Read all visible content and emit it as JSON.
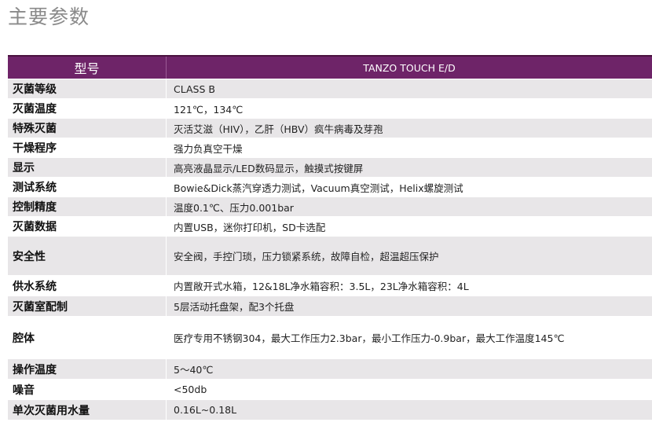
{
  "page": {
    "title": "主要参数"
  },
  "table": {
    "header": {
      "label": "型号",
      "value": "TANZO TOUCH E/D"
    },
    "rows": [
      {
        "label": "灭菌等级",
        "value": "CLASS B"
      },
      {
        "label": "灭菌温度",
        "value": "121℃，134℃"
      },
      {
        "label": "特殊灭菌",
        "value": "灭活艾滋（HIV），乙肝（HBV）疯牛病毒及芽孢"
      },
      {
        "label": "干燥程序",
        "value": "强力负真空干燥"
      },
      {
        "label": "显示",
        "value": "高亮液晶显示/LED数码显示，触摸式按键屏"
      },
      {
        "label": "测试系统",
        "value": "Bowie&Dick蒸汽穿透力测试，Vacuum真空测试，Helix螺旋测试"
      },
      {
        "label": "控制精度",
        "value": "温度0.1℃、压力0.001bar"
      },
      {
        "label": "灭菌数据",
        "value": "内置USB，迷你打印机，SD卡选配"
      },
      {
        "label": "安全性",
        "value": "安全阀，手控门琐，压力锁紧系统，故障自检，超温超压保护"
      },
      {
        "label": "供水系统",
        "value": "内置敞开式水箱，12&18L净水箱容积：3.5L，23L净水箱容积：4L"
      },
      {
        "label": "灭菌室配制",
        "value": "5层活动托盘架，配3个托盘"
      },
      {
        "label": "腔体",
        "value": "医疗专用不锈钢304，最大工作压力2.3bar，最小工作压力-0.9bar，最大工作温度145℃"
      },
      {
        "label": "操作温度",
        "value": "5～40℃"
      },
      {
        "label": "噪音",
        "value": "<50db"
      },
      {
        "label": "单次灭菌用水量",
        "value": "0.16L~0.18L"
      }
    ]
  },
  "colors": {
    "header_bg": "#6e2468",
    "row_alt_bg": "#e8e6e8",
    "title_color": "#8a8a8a"
  }
}
